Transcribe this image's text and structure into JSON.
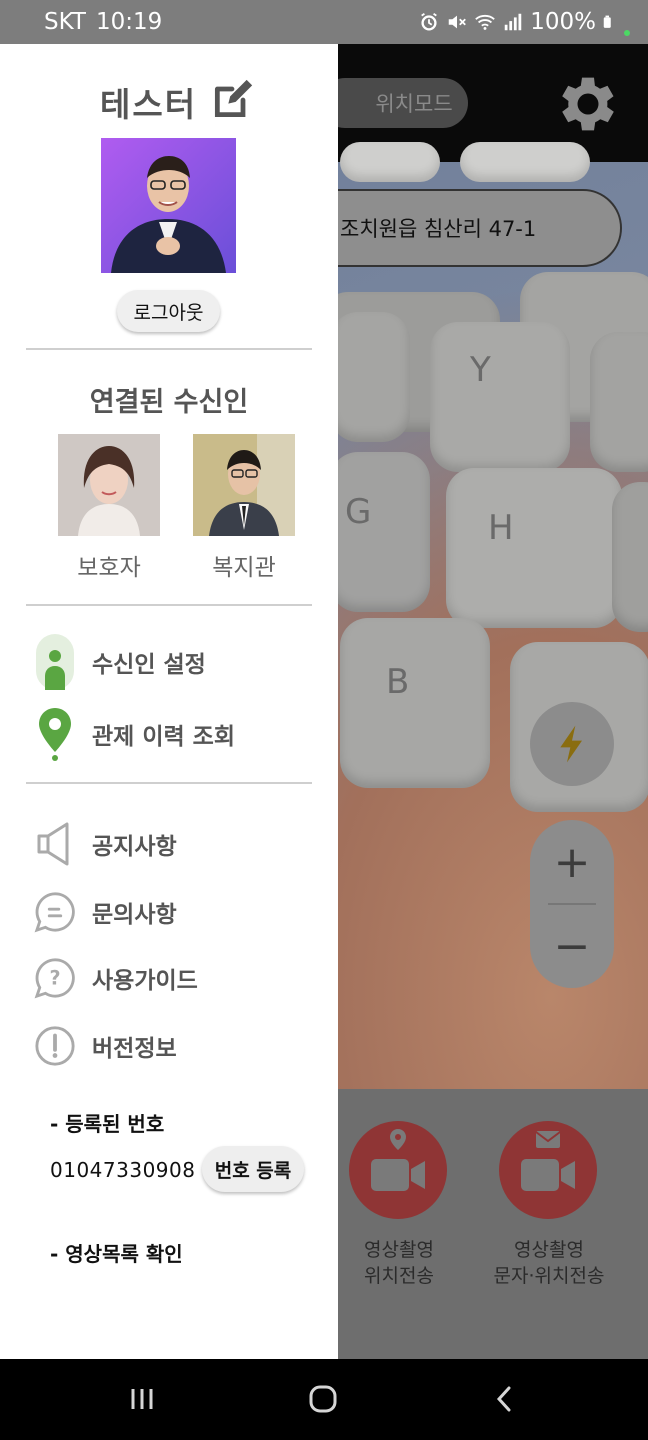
{
  "status_bar": {
    "carrier": "SKT",
    "time": "10:19",
    "battery": "100%",
    "icons": [
      "alarm-icon",
      "mute-icon",
      "wifi-icon",
      "signal-icon",
      "battery-icon"
    ]
  },
  "app": {
    "mode_button": "위치모드",
    "address": "조치원읍 침산리 47-1",
    "zoom_plus": "+",
    "zoom_minus": "−",
    "actions": [
      {
        "line1": "영상촬영",
        "line2": "위치전송",
        "icon": "video-location-icon"
      },
      {
        "line1": "영상촬영",
        "line2": "문자·위치전송",
        "icon": "video-message-icon"
      }
    ],
    "colors": {
      "record_button": "#d94a4a",
      "flash": "#f4c20d"
    }
  },
  "drawer": {
    "user_name": "테스터",
    "logout": "로그아웃",
    "recipients_title": "연결된 수신인",
    "recipients": [
      {
        "label": "보호자"
      },
      {
        "label": "복지관"
      }
    ],
    "menu_primary": [
      {
        "label": "수신인 설정",
        "icon": "person-icon"
      },
      {
        "label": "관제 이력 조회",
        "icon": "location-pin-icon"
      }
    ],
    "menu_secondary": [
      {
        "label": "공지사항",
        "icon": "speaker-icon"
      },
      {
        "label": "문의사항",
        "icon": "chat-bubble-icon"
      },
      {
        "label": "사용가이드",
        "icon": "question-icon"
      },
      {
        "label": "버전정보",
        "icon": "info-exclamation-icon"
      }
    ],
    "registered_title": "- 등록된 번호",
    "phone_number": "01047330908",
    "register_button": "번호 등록",
    "video_list_title": "- 영상목록 확인",
    "colors": {
      "accent_green": "#5aa642"
    }
  }
}
